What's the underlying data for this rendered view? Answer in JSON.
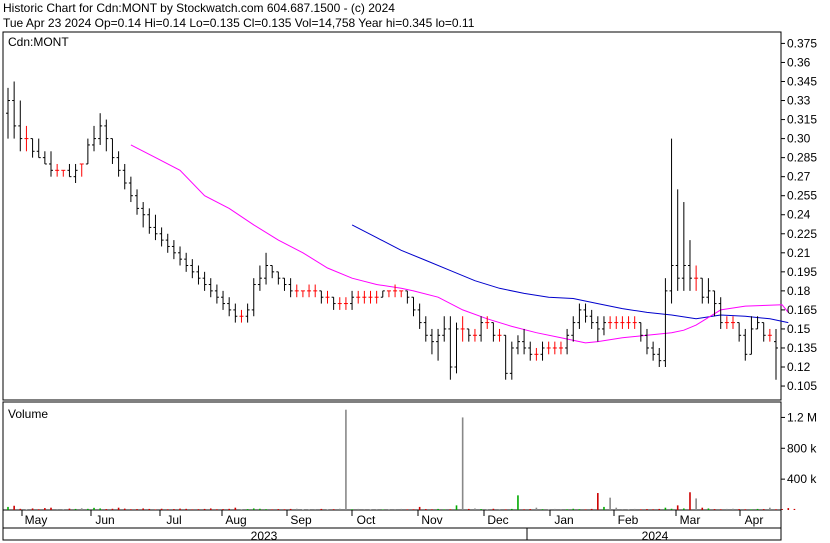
{
  "header": {
    "line1": "Historic Chart for Cdn:MONT by Stockwatch.com 604.687.1500 - (c) 2024",
    "line2": "Tue Apr 23 2024  Op=0.14  Hi=0.14  Lo=0.135  Cl=0.135  Vol=14,758  Year hi=0.345  lo=0.11"
  },
  "chart_data": {
    "type": "ohlc",
    "price_panel_label": "Cdn:MONT",
    "volume_panel_label": "Volume",
    "price_ticks": [
      "0.375",
      "0.36",
      "0.345",
      "0.33",
      "0.315",
      "0.30",
      "0.285",
      "0.27",
      "0.255",
      "0.24",
      "0.225",
      "0.21",
      "0.195",
      "0.18",
      "0.165",
      "0.15",
      "0.135",
      "0.12",
      "0.105"
    ],
    "ylim": [
      0.094,
      0.384
    ],
    "volume_ticks": [
      "1.2 M",
      "800 k",
      "400 k"
    ],
    "volume_ylim": [
      0,
      1400000
    ],
    "month_labels": [
      "May",
      "Jun",
      "Jul",
      "Aug",
      "Sep",
      "Oct",
      "Nov",
      "Dec",
      "Jan",
      "Feb",
      "Mar",
      "Apr"
    ],
    "year_labels": [
      "2023",
      "2024"
    ],
    "colors": {
      "up": "#000000",
      "flat": "#ff0000",
      "ma_short": "#ff00ff",
      "ma_long": "#0000cc",
      "vol_up": "#00aa00",
      "vol_down": "#cc0000",
      "vol_flat": "#888888"
    },
    "ohlc": [
      [
        0.32,
        0.34,
        0.3,
        0.33
      ],
      [
        0.33,
        0.345,
        0.3,
        0.31
      ],
      [
        0.31,
        0.33,
        0.29,
        0.3
      ],
      [
        0.3,
        0.31,
        0.29,
        0.3
      ],
      [
        0.3,
        0.3,
        0.285,
        0.29
      ],
      [
        0.29,
        0.3,
        0.285,
        0.285
      ],
      [
        0.285,
        0.29,
        0.28,
        0.28
      ],
      [
        0.28,
        0.29,
        0.27,
        0.275
      ],
      [
        0.275,
        0.28,
        0.27,
        0.275
      ],
      [
        0.275,
        0.275,
        0.27,
        0.275
      ],
      [
        0.275,
        0.28,
        0.27,
        0.27
      ],
      [
        0.27,
        0.28,
        0.265,
        0.275
      ],
      [
        0.28,
        0.28,
        0.27,
        0.28
      ],
      [
        0.28,
        0.3,
        0.28,
        0.295
      ],
      [
        0.295,
        0.31,
        0.29,
        0.3
      ],
      [
        0.3,
        0.32,
        0.295,
        0.31
      ],
      [
        0.31,
        0.315,
        0.29,
        0.3
      ],
      [
        0.3,
        0.3,
        0.28,
        0.285
      ],
      [
        0.285,
        0.29,
        0.27,
        0.275
      ],
      [
        0.275,
        0.28,
        0.26,
        0.265
      ],
      [
        0.265,
        0.27,
        0.25,
        0.255
      ],
      [
        0.255,
        0.26,
        0.24,
        0.245
      ],
      [
        0.245,
        0.25,
        0.23,
        0.24
      ],
      [
        0.24,
        0.245,
        0.225,
        0.23
      ],
      [
        0.23,
        0.24,
        0.22,
        0.225
      ],
      [
        0.225,
        0.23,
        0.215,
        0.22
      ],
      [
        0.22,
        0.225,
        0.21,
        0.215
      ],
      [
        0.215,
        0.22,
        0.205,
        0.21
      ],
      [
        0.21,
        0.215,
        0.2,
        0.205
      ],
      [
        0.205,
        0.21,
        0.195,
        0.2
      ],
      [
        0.2,
        0.205,
        0.19,
        0.195
      ],
      [
        0.195,
        0.2,
        0.185,
        0.19
      ],
      [
        0.19,
        0.195,
        0.18,
        0.185
      ],
      [
        0.185,
        0.19,
        0.175,
        0.18
      ],
      [
        0.18,
        0.185,
        0.17,
        0.175
      ],
      [
        0.175,
        0.18,
        0.165,
        0.17
      ],
      [
        0.17,
        0.175,
        0.16,
        0.165
      ],
      [
        0.165,
        0.17,
        0.155,
        0.16
      ],
      [
        0.16,
        0.165,
        0.155,
        0.16
      ],
      [
        0.16,
        0.17,
        0.155,
        0.165
      ],
      [
        0.165,
        0.19,
        0.16,
        0.185
      ],
      [
        0.185,
        0.2,
        0.18,
        0.19
      ],
      [
        0.19,
        0.21,
        0.185,
        0.2
      ],
      [
        0.2,
        0.2,
        0.19,
        0.195
      ],
      [
        0.195,
        0.195,
        0.185,
        0.19
      ],
      [
        0.19,
        0.19,
        0.18,
        0.185
      ],
      [
        0.185,
        0.19,
        0.175,
        0.18
      ],
      [
        0.18,
        0.185,
        0.175,
        0.18
      ],
      [
        0.18,
        0.18,
        0.175,
        0.18
      ],
      [
        0.18,
        0.185,
        0.175,
        0.18
      ],
      [
        0.18,
        0.185,
        0.175,
        0.18
      ],
      [
        0.18,
        0.18,
        0.17,
        0.175
      ],
      [
        0.175,
        0.18,
        0.17,
        0.175
      ],
      [
        0.175,
        0.175,
        0.165,
        0.17
      ],
      [
        0.17,
        0.175,
        0.165,
        0.17
      ],
      [
        0.17,
        0.175,
        0.165,
        0.17
      ],
      [
        0.17,
        0.18,
        0.165,
        0.175
      ],
      [
        0.175,
        0.18,
        0.17,
        0.175
      ],
      [
        0.175,
        0.18,
        0.17,
        0.175
      ],
      [
        0.175,
        0.18,
        0.17,
        0.175
      ],
      [
        0.175,
        0.18,
        0.17,
        0.175
      ],
      [
        0.175,
        0.18,
        0.175,
        0.18
      ],
      [
        0.18,
        0.18,
        0.175,
        0.18
      ],
      [
        0.18,
        0.185,
        0.175,
        0.18
      ],
      [
        0.18,
        0.18,
        0.175,
        0.18
      ],
      [
        0.18,
        0.18,
        0.17,
        0.175
      ],
      [
        0.175,
        0.175,
        0.16,
        0.165
      ],
      [
        0.165,
        0.17,
        0.15,
        0.155
      ],
      [
        0.155,
        0.16,
        0.14,
        0.145
      ],
      [
        0.145,
        0.15,
        0.13,
        0.14
      ],
      [
        0.14,
        0.15,
        0.125,
        0.145
      ],
      [
        0.145,
        0.16,
        0.14,
        0.15
      ],
      [
        0.15,
        0.16,
        0.11,
        0.12
      ],
      [
        0.12,
        0.155,
        0.115,
        0.15
      ],
      [
        0.15,
        0.16,
        0.14,
        0.15
      ],
      [
        0.15,
        0.15,
        0.14,
        0.145
      ],
      [
        0.145,
        0.15,
        0.14,
        0.145
      ],
      [
        0.145,
        0.16,
        0.14,
        0.155
      ],
      [
        0.155,
        0.16,
        0.15,
        0.155
      ],
      [
        0.155,
        0.155,
        0.14,
        0.145
      ],
      [
        0.145,
        0.15,
        0.14,
        0.145
      ],
      [
        0.145,
        0.145,
        0.11,
        0.115
      ],
      [
        0.115,
        0.14,
        0.11,
        0.135
      ],
      [
        0.135,
        0.145,
        0.13,
        0.14
      ],
      [
        0.14,
        0.15,
        0.13,
        0.135
      ],
      [
        0.135,
        0.14,
        0.125,
        0.13
      ],
      [
        0.13,
        0.135,
        0.125,
        0.13
      ],
      [
        0.13,
        0.14,
        0.125,
        0.135
      ],
      [
        0.135,
        0.14,
        0.13,
        0.135
      ],
      [
        0.135,
        0.14,
        0.13,
        0.135
      ],
      [
        0.135,
        0.14,
        0.13,
        0.135
      ],
      [
        0.135,
        0.15,
        0.13,
        0.145
      ],
      [
        0.145,
        0.16,
        0.14,
        0.155
      ],
      [
        0.155,
        0.17,
        0.15,
        0.165
      ],
      [
        0.165,
        0.17,
        0.155,
        0.16
      ],
      [
        0.16,
        0.165,
        0.15,
        0.155
      ],
      [
        0.155,
        0.16,
        0.14,
        0.15
      ],
      [
        0.15,
        0.16,
        0.145,
        0.155
      ],
      [
        0.155,
        0.16,
        0.15,
        0.155
      ],
      [
        0.155,
        0.16,
        0.15,
        0.155
      ],
      [
        0.155,
        0.16,
        0.15,
        0.155
      ],
      [
        0.155,
        0.16,
        0.15,
        0.155
      ],
      [
        0.155,
        0.16,
        0.15,
        0.155
      ],
      [
        0.155,
        0.155,
        0.14,
        0.145
      ],
      [
        0.145,
        0.15,
        0.13,
        0.135
      ],
      [
        0.135,
        0.14,
        0.125,
        0.13
      ],
      [
        0.13,
        0.135,
        0.12,
        0.125
      ],
      [
        0.125,
        0.19,
        0.12,
        0.18
      ],
      [
        0.18,
        0.3,
        0.17,
        0.2
      ],
      [
        0.2,
        0.26,
        0.18,
        0.19
      ],
      [
        0.19,
        0.25,
        0.18,
        0.2
      ],
      [
        0.2,
        0.22,
        0.18,
        0.19
      ],
      [
        0.19,
        0.2,
        0.18,
        0.19
      ],
      [
        0.19,
        0.19,
        0.17,
        0.175
      ],
      [
        0.175,
        0.19,
        0.17,
        0.18
      ],
      [
        0.18,
        0.18,
        0.16,
        0.17
      ],
      [
        0.17,
        0.175,
        0.15,
        0.155
      ],
      [
        0.155,
        0.16,
        0.15,
        0.155
      ],
      [
        0.155,
        0.16,
        0.15,
        0.155
      ],
      [
        0.155,
        0.155,
        0.14,
        0.145
      ],
      [
        0.145,
        0.15,
        0.125,
        0.13
      ],
      [
        0.13,
        0.16,
        0.13,
        0.15
      ],
      [
        0.15,
        0.16,
        0.15,
        0.155
      ],
      [
        0.155,
        0.155,
        0.14,
        0.145
      ],
      [
        0.145,
        0.15,
        0.14,
        0.145
      ],
      [
        0.14,
        0.15,
        0.11,
        0.135
      ]
    ],
    "ma_short": [
      [
        20,
        0.295
      ],
      [
        24,
        0.285
      ],
      [
        28,
        0.275
      ],
      [
        32,
        0.255
      ],
      [
        36,
        0.245
      ],
      [
        40,
        0.232
      ],
      [
        44,
        0.22
      ],
      [
        48,
        0.21
      ],
      [
        52,
        0.198
      ],
      [
        56,
        0.19
      ],
      [
        60,
        0.185
      ],
      [
        64,
        0.182
      ],
      [
        66,
        0.18
      ],
      [
        70,
        0.175
      ],
      [
        74,
        0.165
      ],
      [
        78,
        0.158
      ],
      [
        82,
        0.152
      ],
      [
        86,
        0.147
      ],
      [
        90,
        0.143
      ],
      [
        94,
        0.139
      ],
      [
        96,
        0.14
      ],
      [
        100,
        0.143
      ],
      [
        104,
        0.145
      ],
      [
        108,
        0.147
      ],
      [
        110,
        0.149
      ],
      [
        112,
        0.153
      ],
      [
        116,
        0.165
      ],
      [
        120,
        0.168
      ],
      [
        126,
        0.169
      ],
      [
        127,
        0.163
      ]
    ],
    "ma_long": [
      [
        56,
        0.232
      ],
      [
        60,
        0.222
      ],
      [
        64,
        0.212
      ],
      [
        68,
        0.204
      ],
      [
        72,
        0.196
      ],
      [
        76,
        0.188
      ],
      [
        80,
        0.182
      ],
      [
        84,
        0.178
      ],
      [
        88,
        0.175
      ],
      [
        92,
        0.174
      ],
      [
        96,
        0.17
      ],
      [
        100,
        0.166
      ],
      [
        104,
        0.163
      ],
      [
        108,
        0.161
      ],
      [
        112,
        0.158
      ],
      [
        116,
        0.161
      ],
      [
        120,
        0.16
      ],
      [
        124,
        0.158
      ],
      [
        127,
        0.155
      ]
    ],
    "volume": [
      40000,
      55000,
      15000,
      8000,
      20000,
      10000,
      25000,
      30000,
      12000,
      10000,
      18000,
      14000,
      22000,
      15000,
      28000,
      20000,
      12000,
      16000,
      30000,
      18000,
      10000,
      12000,
      20000,
      14000,
      8000,
      16000,
      10000,
      12000,
      18000,
      15000,
      9000,
      11000,
      14000,
      20000,
      10000,
      12000,
      15000,
      30000,
      10000,
      12000,
      20000,
      16000,
      11000,
      9000,
      12000,
      10000,
      14000,
      16000,
      8000,
      10000,
      12000,
      14000,
      9000,
      11000,
      16000,
      1300000,
      10000,
      14000,
      12000,
      9000,
      11000,
      8000,
      10000,
      12000,
      14000,
      9000,
      10000,
      40000,
      12000,
      10000,
      14000,
      9000,
      10000,
      60000,
      1200000,
      14000,
      20000,
      12000,
      10000,
      16000,
      11000,
      9000,
      14000,
      190000,
      10000,
      12000,
      30000,
      11000,
      9000,
      14000,
      12000,
      10000,
      16000,
      11000,
      9000,
      14000,
      220000,
      40000,
      160000,
      30000,
      12000,
      10000,
      14000,
      9000,
      12000,
      10000,
      14000,
      30000,
      16000,
      60000,
      20000,
      230000,
      150000,
      30000,
      20000,
      12000,
      10000,
      14000,
      16000,
      12000,
      10000,
      9000,
      14000,
      12000,
      30000,
      10000,
      12000,
      25000,
      14000
    ]
  }
}
